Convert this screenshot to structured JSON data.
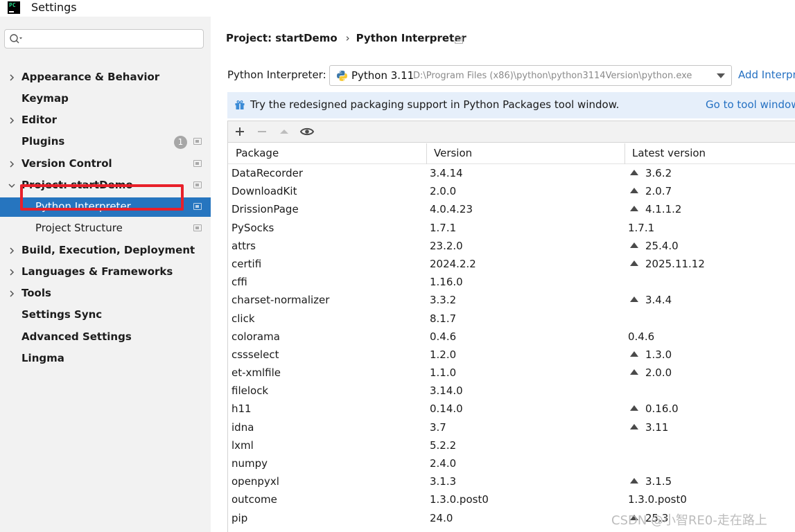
{
  "window": {
    "title": "Settings",
    "app_icon_text": "PC"
  },
  "sidebar": {
    "search_placeholder": "",
    "items": [
      {
        "label": "Appearance & Behavior",
        "expandable": true,
        "expanded": false
      },
      {
        "label": "Keymap",
        "expandable": false
      },
      {
        "label": "Editor",
        "expandable": true,
        "expanded": false
      },
      {
        "label": "Plugins",
        "expandable": false,
        "badge": "1"
      },
      {
        "label": "Version Control",
        "expandable": true,
        "expanded": false
      },
      {
        "label": "Project: startDemo",
        "expandable": true,
        "expanded": true
      },
      {
        "label": "Python Interpreter",
        "sub": true,
        "selected": true
      },
      {
        "label": "Project Structure",
        "sub": true
      },
      {
        "label": "Build, Execution, Deployment",
        "expandable": true,
        "expanded": false
      },
      {
        "label": "Languages & Frameworks",
        "expandable": true,
        "expanded": false
      },
      {
        "label": "Tools",
        "expandable": true,
        "expanded": false
      },
      {
        "label": "Settings Sync",
        "expandable": false
      },
      {
        "label": "Advanced Settings",
        "expandable": false
      },
      {
        "label": "Lingma",
        "expandable": false
      }
    ]
  },
  "breadcrumb": {
    "parent": "Project: startDemo",
    "separator": "›",
    "current": "Python Interpreter"
  },
  "interpreter": {
    "label": "Python Interpreter:",
    "name": "Python 3.11",
    "path": "D:\\Program Files (x86)\\python\\python3114Version\\python.exe",
    "add_label": "Add Interpreter"
  },
  "banner": {
    "text": "Try the redesigned packaging support in Python Packages tool window.",
    "link": "Go to tool window"
  },
  "table": {
    "columns": [
      "Package",
      "Version",
      "Latest version"
    ],
    "rows": [
      {
        "package": "DataRecorder",
        "version": "3.4.14",
        "latest": "3.6.2",
        "upgrade": true
      },
      {
        "package": "DownloadKit",
        "version": "2.0.0",
        "latest": "2.0.7",
        "upgrade": true
      },
      {
        "package": "DrissionPage",
        "version": "4.0.4.23",
        "latest": "4.1.1.2",
        "upgrade": true
      },
      {
        "package": "PySocks",
        "version": "1.7.1",
        "latest": "1.7.1",
        "upgrade": false
      },
      {
        "package": "attrs",
        "version": "23.2.0",
        "latest": "25.4.0",
        "upgrade": true
      },
      {
        "package": "certifi",
        "version": "2024.2.2",
        "latest": "2025.11.12",
        "upgrade": true
      },
      {
        "package": "cffi",
        "version": "1.16.0",
        "latest": "",
        "upgrade": false
      },
      {
        "package": "charset-normalizer",
        "version": "3.3.2",
        "latest": "3.4.4",
        "upgrade": true
      },
      {
        "package": "click",
        "version": "8.1.7",
        "latest": "",
        "upgrade": false
      },
      {
        "package": "colorama",
        "version": "0.4.6",
        "latest": "0.4.6",
        "upgrade": false
      },
      {
        "package": "cssselect",
        "version": "1.2.0",
        "latest": "1.3.0",
        "upgrade": true
      },
      {
        "package": "et-xmlfile",
        "version": "1.1.0",
        "latest": "2.0.0",
        "upgrade": true
      },
      {
        "package": "filelock",
        "version": "3.14.0",
        "latest": "",
        "upgrade": false
      },
      {
        "package": "h11",
        "version": "0.14.0",
        "latest": "0.16.0",
        "upgrade": true
      },
      {
        "package": "idna",
        "version": "3.7",
        "latest": "3.11",
        "upgrade": true
      },
      {
        "package": "lxml",
        "version": "5.2.2",
        "latest": "",
        "upgrade": false
      },
      {
        "package": "numpy",
        "version": "2.4.0",
        "latest": "",
        "upgrade": false
      },
      {
        "package": "openpyxl",
        "version": "3.1.3",
        "latest": "3.1.5",
        "upgrade": true
      },
      {
        "package": "outcome",
        "version": "1.3.0.post0",
        "latest": "1.3.0.post0",
        "upgrade": false
      },
      {
        "package": "pip",
        "version": "24.0",
        "latest": "25.3",
        "upgrade": true
      }
    ]
  },
  "watermark": "CSDN @小智RE0-走在路上",
  "colors": {
    "selection": "#2675bf",
    "link": "#2470c2",
    "highlight_border": "#e8202a",
    "banner_bg": "#e6effa"
  }
}
